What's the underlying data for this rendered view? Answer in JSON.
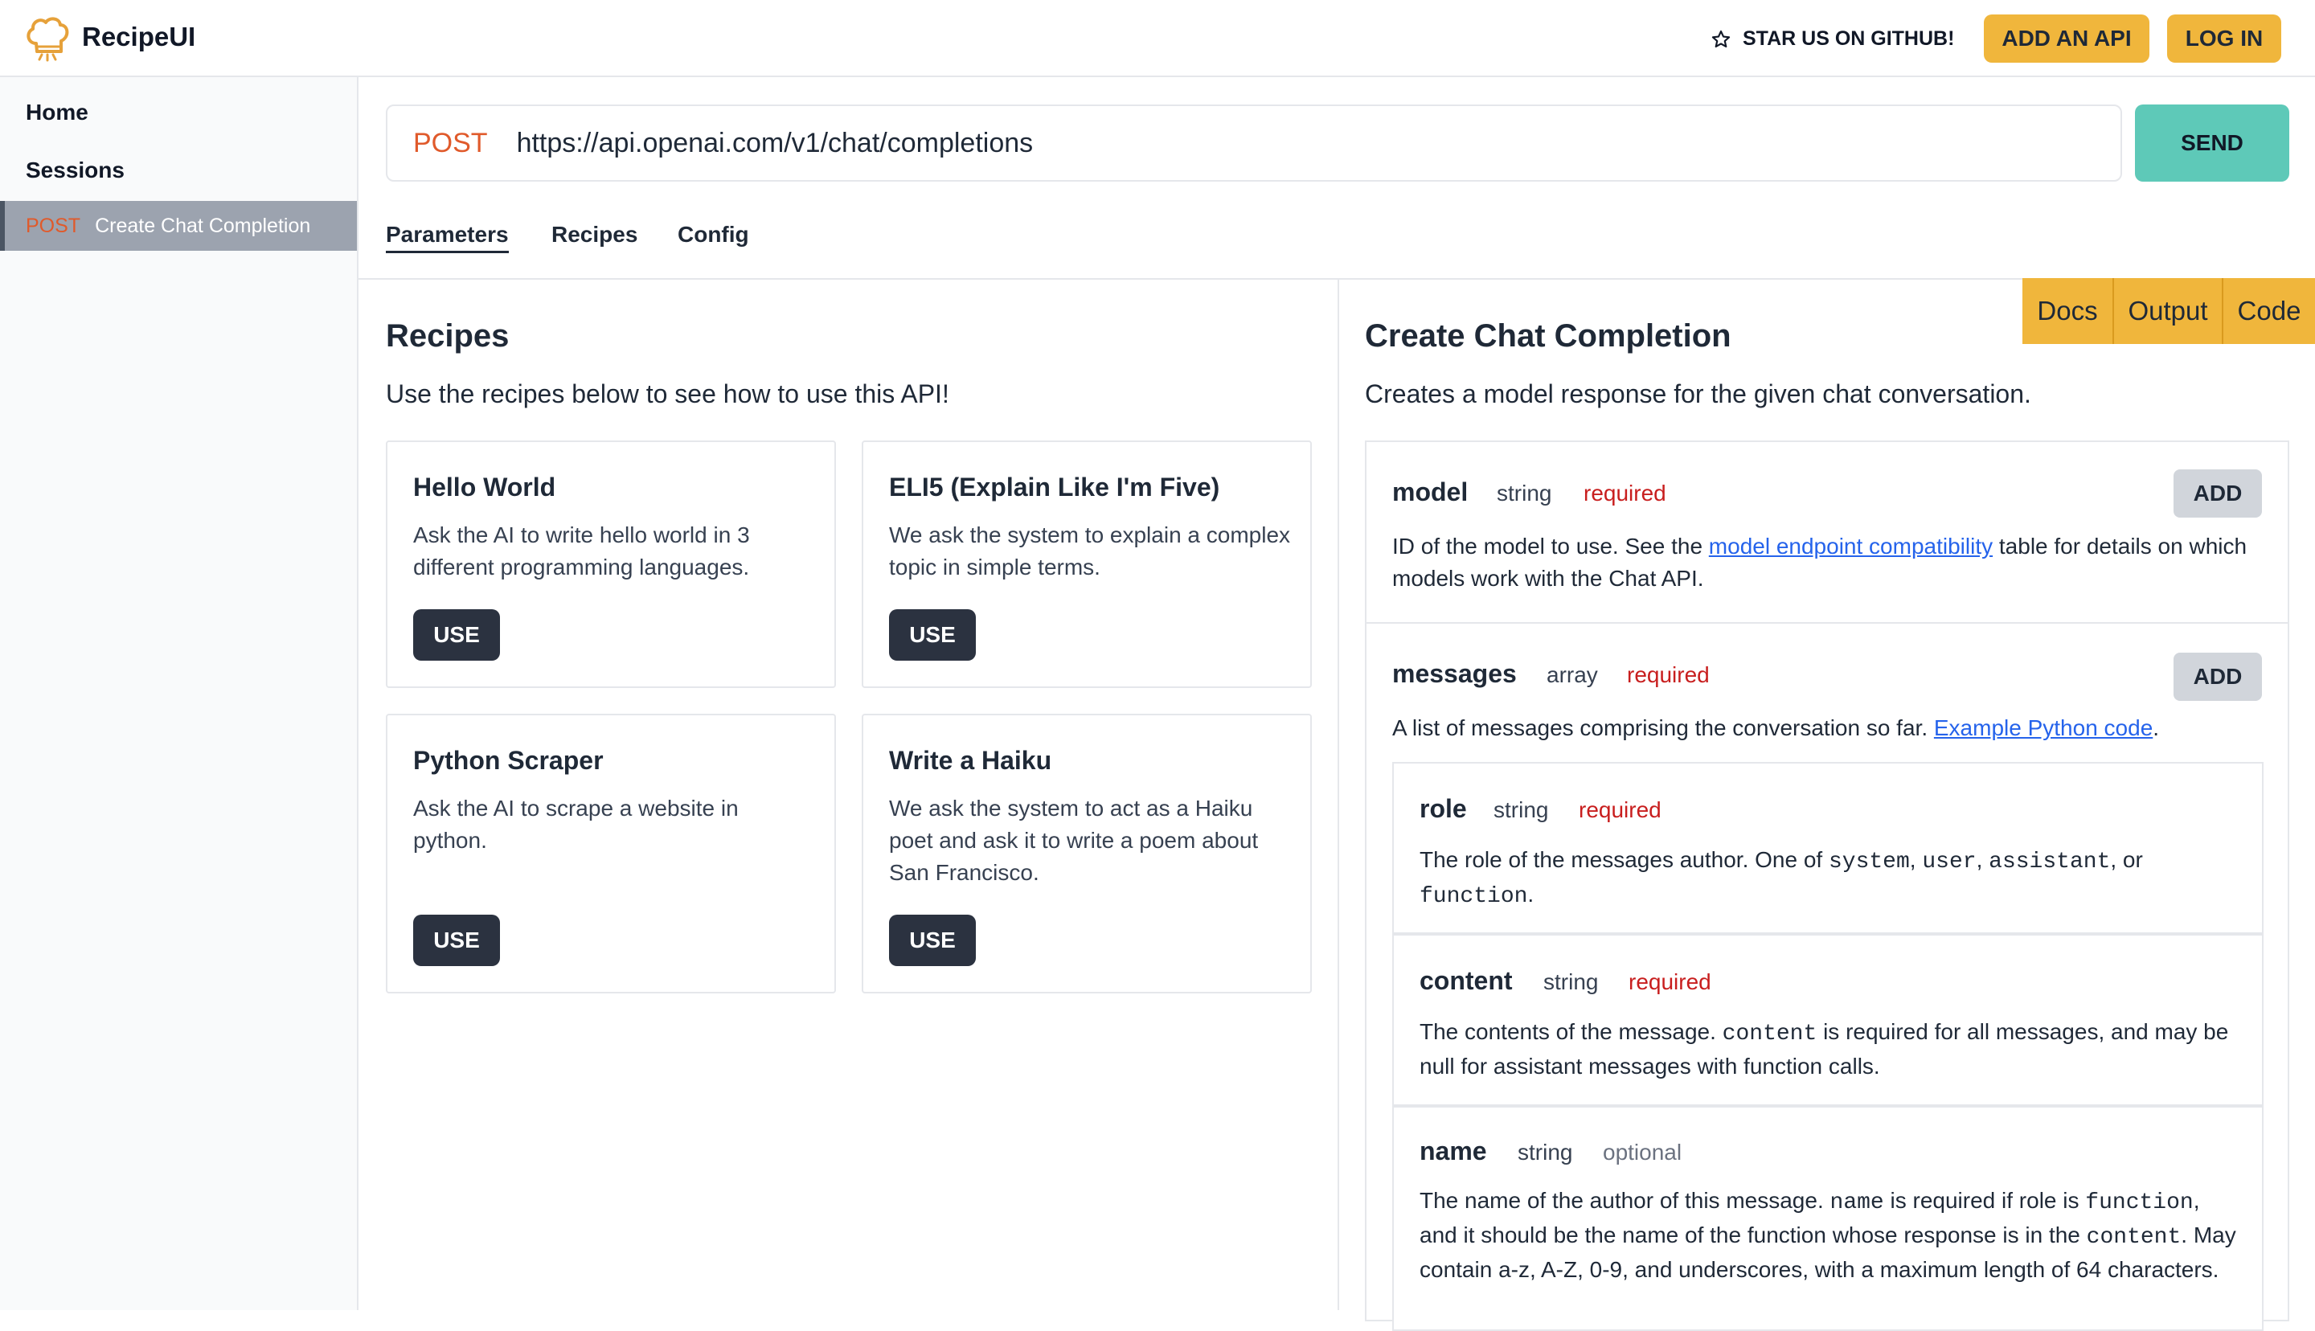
{
  "app": {
    "brand": "RecipeUI",
    "star_link": "STAR US ON GITHUB!",
    "add_api": "ADD AN API",
    "log_in": "LOG IN"
  },
  "sidebar": {
    "home": "Home",
    "sessions": "Sessions",
    "active_session": {
      "method": "POST",
      "label": "Create Chat Completion"
    }
  },
  "request": {
    "method": "POST",
    "url": "https://api.openai.com/v1/chat/completions",
    "send": "SEND"
  },
  "tabs": [
    "Parameters",
    "Recipes",
    "Config"
  ],
  "recipes": {
    "heading": "Recipes",
    "subheading": "Use the recipes below to see how to use this API!",
    "use_label": "USE",
    "items": [
      {
        "title": "Hello World",
        "description": "Ask the AI to write hello world in 3 different programming languages."
      },
      {
        "title": "ELI5 (Explain Like I'm Five)",
        "description": "We ask the system to explain a complex topic in simple terms."
      },
      {
        "title": "Python Scraper",
        "description": "Ask the AI to scrape a website in python."
      },
      {
        "title": "Write a Haiku",
        "description": "We ask the system to act as a Haiku poet and ask it to write a poem about San Francisco."
      }
    ]
  },
  "docs": {
    "tabs": [
      "Docs",
      "Output",
      "Code"
    ],
    "heading": "Create Chat Completion",
    "subheading": "Creates a model response for the given chat conversation.",
    "add_label": "ADD",
    "model": {
      "name": "model",
      "type": "string",
      "req": "required",
      "desc_pre": "ID of the model to use. See the ",
      "desc_link": "model endpoint compatibility",
      "desc_post": " table for details on which models work with the Chat API."
    },
    "messages": {
      "name": "messages",
      "type": "array",
      "req": "required",
      "desc_pre": "A list of messages comprising the conversation so far. ",
      "desc_link": "Example Python code",
      "desc_post": "."
    },
    "role": {
      "name": "role",
      "type": "string",
      "req": "required",
      "desc_1": "The role of the messages author. One of ",
      "code_1": "system",
      "sep_1": ", ",
      "code_2": "user",
      "sep_2": ", ",
      "code_3": "assistant",
      "sep_3": ", or ",
      "code_4": "function",
      "end": "."
    },
    "content": {
      "name": "content",
      "type": "string",
      "req": "required",
      "desc_1": "The contents of the message. ",
      "code_1": "content",
      "desc_2": " is required for all messages, and may be null for assistant messages with function calls."
    },
    "name_param": {
      "name": "name",
      "type": "string",
      "req": "optional",
      "desc_1": "The name of the author of this message. ",
      "code_1": "name",
      "desc_2": " is required if role is ",
      "code_2": "function",
      "desc_3": ", and it should be the name of the function whose response is in the ",
      "code_3": "content",
      "desc_4": ". May contain a-z, A-Z, 0-9, and underscores, with a maximum length of 64 characters."
    }
  }
}
